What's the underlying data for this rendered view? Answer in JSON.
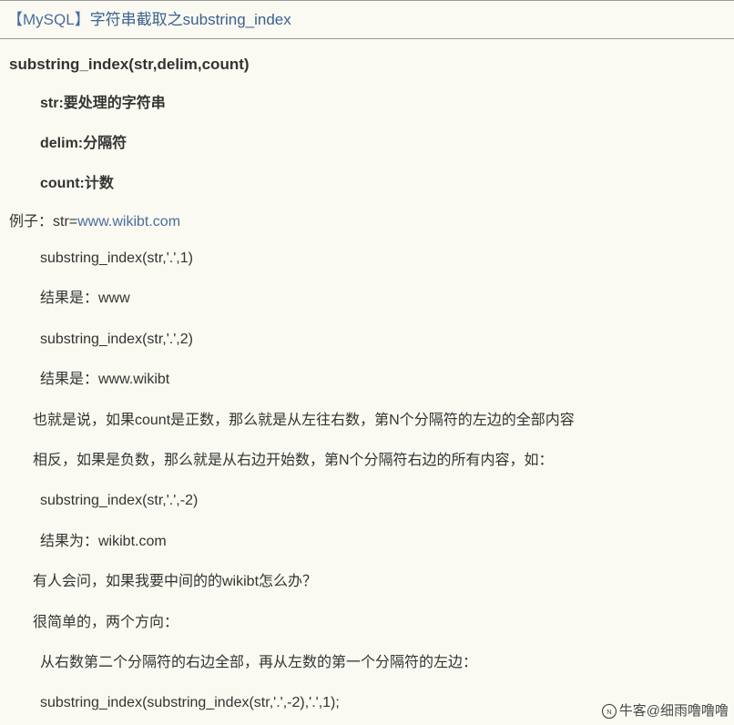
{
  "title": {
    "bracket_open": "【",
    "category": "MySQL",
    "bracket_close": "】",
    "text": "字符串截取之substring_index"
  },
  "signature": "substring_index(str,delim,count)",
  "params": {
    "str": "str:要处理的字符串",
    "delim": "delim:分隔符",
    "count": "count:计数"
  },
  "example": {
    "intro_prefix": "例子：str=",
    "link_text": "www.wikibt.com"
  },
  "lines": {
    "l1": "substring_index(str,'.',1)",
    "l2": "结果是：www",
    "l3": "substring_index(str,'.',2)",
    "l4": "结果是：www.wikibt",
    "l5": "也就是说，如果count是正数，那么就是从左往右数，第N个分隔符的左边的全部内容",
    "l6": "相反，如果是负数，那么就是从右边开始数，第N个分隔符右边的所有内容，如：",
    "l7": "substring_index(str,'.',-2)",
    "l8": "结果为：wikibt.com",
    "l9": "有人会问，如果我要中间的的wikibt怎么办？",
    "l10": "很简单的，两个方向：",
    "l11": "从右数第二个分隔符的右边全部，再从左数的第一个分隔符的左边：",
    "l12": "substring_index(substring_index(str,'.',-2),'.',1);"
  },
  "watermark": "牛客@细雨噜噜噜"
}
